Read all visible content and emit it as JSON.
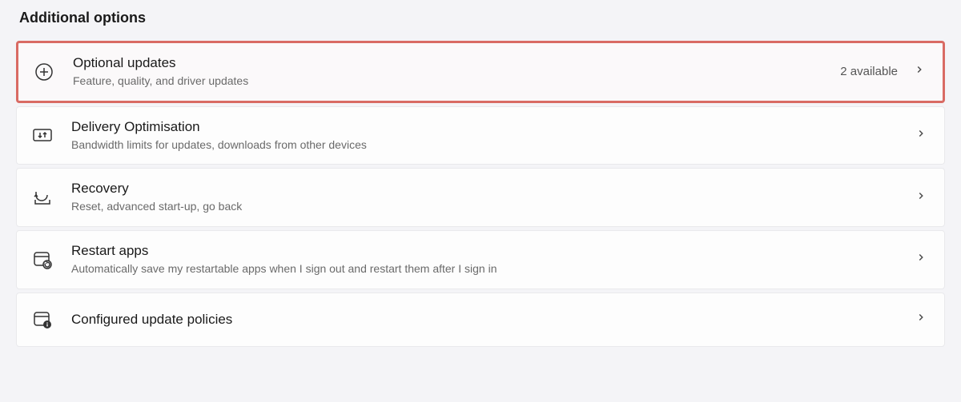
{
  "section_header": "Additional options",
  "items": [
    {
      "title": "Optional updates",
      "desc": "Feature, quality, and driver updates",
      "status": "2 available"
    },
    {
      "title": "Delivery Optimisation",
      "desc": "Bandwidth limits for updates, downloads from other devices",
      "status": ""
    },
    {
      "title": "Recovery",
      "desc": "Reset, advanced start-up, go back",
      "status": ""
    },
    {
      "title": "Restart apps",
      "desc": "Automatically save my restartable apps when I sign out and restart them after I sign in",
      "status": ""
    },
    {
      "title": "Configured update policies",
      "desc": "",
      "status": ""
    }
  ]
}
